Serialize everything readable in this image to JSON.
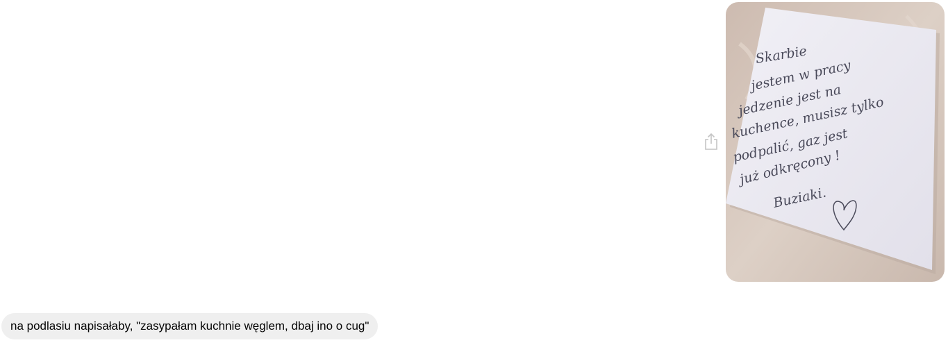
{
  "conversation": {
    "photo_message": {
      "share_icon": "share-icon",
      "image_semantic": "handwritten-sticky-note-photo",
      "note_lines": [
        "Skarbie",
        "jestem w pracy",
        "jedzenie jest na",
        "kuchence, musisz tylko",
        "podpalić, gaz jest",
        "już odkręcony !",
        "Buziaki."
      ],
      "heart_icon": "heart-doodle"
    },
    "reply_message": {
      "text": "na podlasiu napisałaby, \"zasypałam kuchnie węglem, dbaj ino o cug\""
    }
  },
  "colors": {
    "bubble_bg": "#efefef",
    "text": "#050505",
    "note_paper": "#ecebf2",
    "countertop": "#d8c8bd",
    "ink": "#4a4a5a"
  }
}
